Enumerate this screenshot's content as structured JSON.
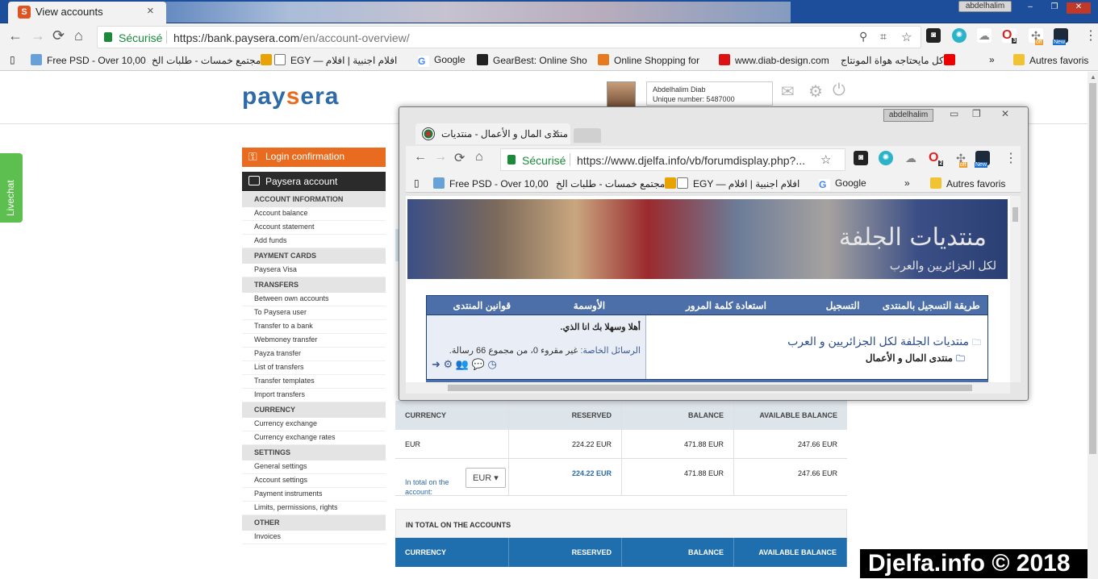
{
  "browser": {
    "tab_title": "View accounts",
    "tab_favicon_letter": "S",
    "tab_close": "×",
    "window_user": "abdelhalim",
    "window_controls": [
      "–",
      "❐",
      "✕"
    ],
    "secure_label": "Sécurisé",
    "url_host": "https://bank.paysera.com",
    "url_path": "/en/account-overview/",
    "bookmarks": [
      "Free PSD - Over 10,00",
      "مجتمع خمسات - طلبات الخ",
      "EGY — افلام اجنبية | افلام",
      "Google",
      "GearBest: Online Sho",
      "Online Shopping for",
      "www.diab-design.com",
      "كل مايحتاجه هواة المونتاج",
      "Autres favoris"
    ],
    "bookmarks_more": "»",
    "ext_badges": {
      "opera_count": "3",
      "off": "off",
      "new": "New"
    }
  },
  "paysera": {
    "logo_pay": "pay",
    "logo_s": "s",
    "logo_era": "era",
    "user_name": "Abdelhalim Diab",
    "unique_number": "Unique number: 5487000",
    "livechat": "Livechat",
    "login_confirmation": "Login confirmation",
    "paysera_account": "Paysera account",
    "menu": [
      {
        "heading": "ACCOUNT INFORMATION",
        "items": [
          "Account balance",
          "Account statement",
          "Add funds"
        ]
      },
      {
        "heading": "PAYMENT CARDS",
        "items": [
          "Paysera Visa"
        ]
      },
      {
        "heading": "TRANSFERS",
        "items": [
          "Between own accounts",
          "To Paysera user",
          "Transfer to a bank",
          "Webmoney transfer",
          "Payza transfer",
          "List of transfers",
          "Transfer templates",
          "Import transfers"
        ]
      },
      {
        "heading": "CURRENCY",
        "items": [
          "Currency exchange",
          "Currency exchange rates"
        ]
      },
      {
        "heading": "SETTINGS",
        "items": [
          "General settings",
          "Account settings",
          "Payment instruments",
          "Limits, permissions, rights"
        ]
      },
      {
        "heading": "OTHER",
        "items": [
          "Invoices"
        ]
      }
    ],
    "table1": {
      "headers": [
        "CURRENCY",
        "RESERVED",
        "BALANCE",
        "AVAILABLE BALANCE"
      ],
      "row": [
        "EUR",
        "224.22 EUR",
        "471.88 EUR",
        "247.66 EUR"
      ],
      "total_label": "In total on the account:",
      "total_currency": "EUR",
      "total_row": [
        "224.22 EUR",
        "471.88 EUR",
        "247.66 EUR"
      ]
    },
    "table2": {
      "title": "IN TOTAL ON THE ACCOUNTS",
      "headers": [
        "CURRENCY",
        "RESERVED",
        "BALANCE",
        "AVAILABLE BALANCE"
      ]
    }
  },
  "popup": {
    "window_user": "abdelhalim",
    "tab_title": "منتدى المال و الأعمال - منتديات",
    "tab_close": "×",
    "secure_label": "Sécurisé",
    "url": "https://www.djelfa.info/vb/forumdisplay.php?...",
    "bookmarks": [
      "Free PSD - Over 10,00",
      "مجتمع خمسات - طلبات الخ",
      "EGY — افلام اجنبية | افلام",
      "Google",
      "Autres favoris"
    ],
    "ext_badges": {
      "opera_count": "2",
      "off": "off",
      "new": "New"
    },
    "banner_title": "منتديات الجلفة",
    "banner_subtitle": "لكل الجزائريين والعرب",
    "nav": [
      "طريقة التسجيل بالمنتدى",
      "التسجيل",
      "استعادة كلمة المرور",
      "الأوسمة",
      "قوانين المنتدى"
    ],
    "welcome": "أهلا وسهلا بك انا الذي.",
    "private_msgs_label": "الرسائل الخاصة:",
    "private_msgs_value": "غير مقروء 0، من مجموع 66 رسالة.",
    "crumb_forums": "منتديات الجلفة لكل الجزائريين و العرب",
    "crumb_current": "منتدى المال و الأعمال"
  },
  "watermark": "Djelfa.info © 2018"
}
